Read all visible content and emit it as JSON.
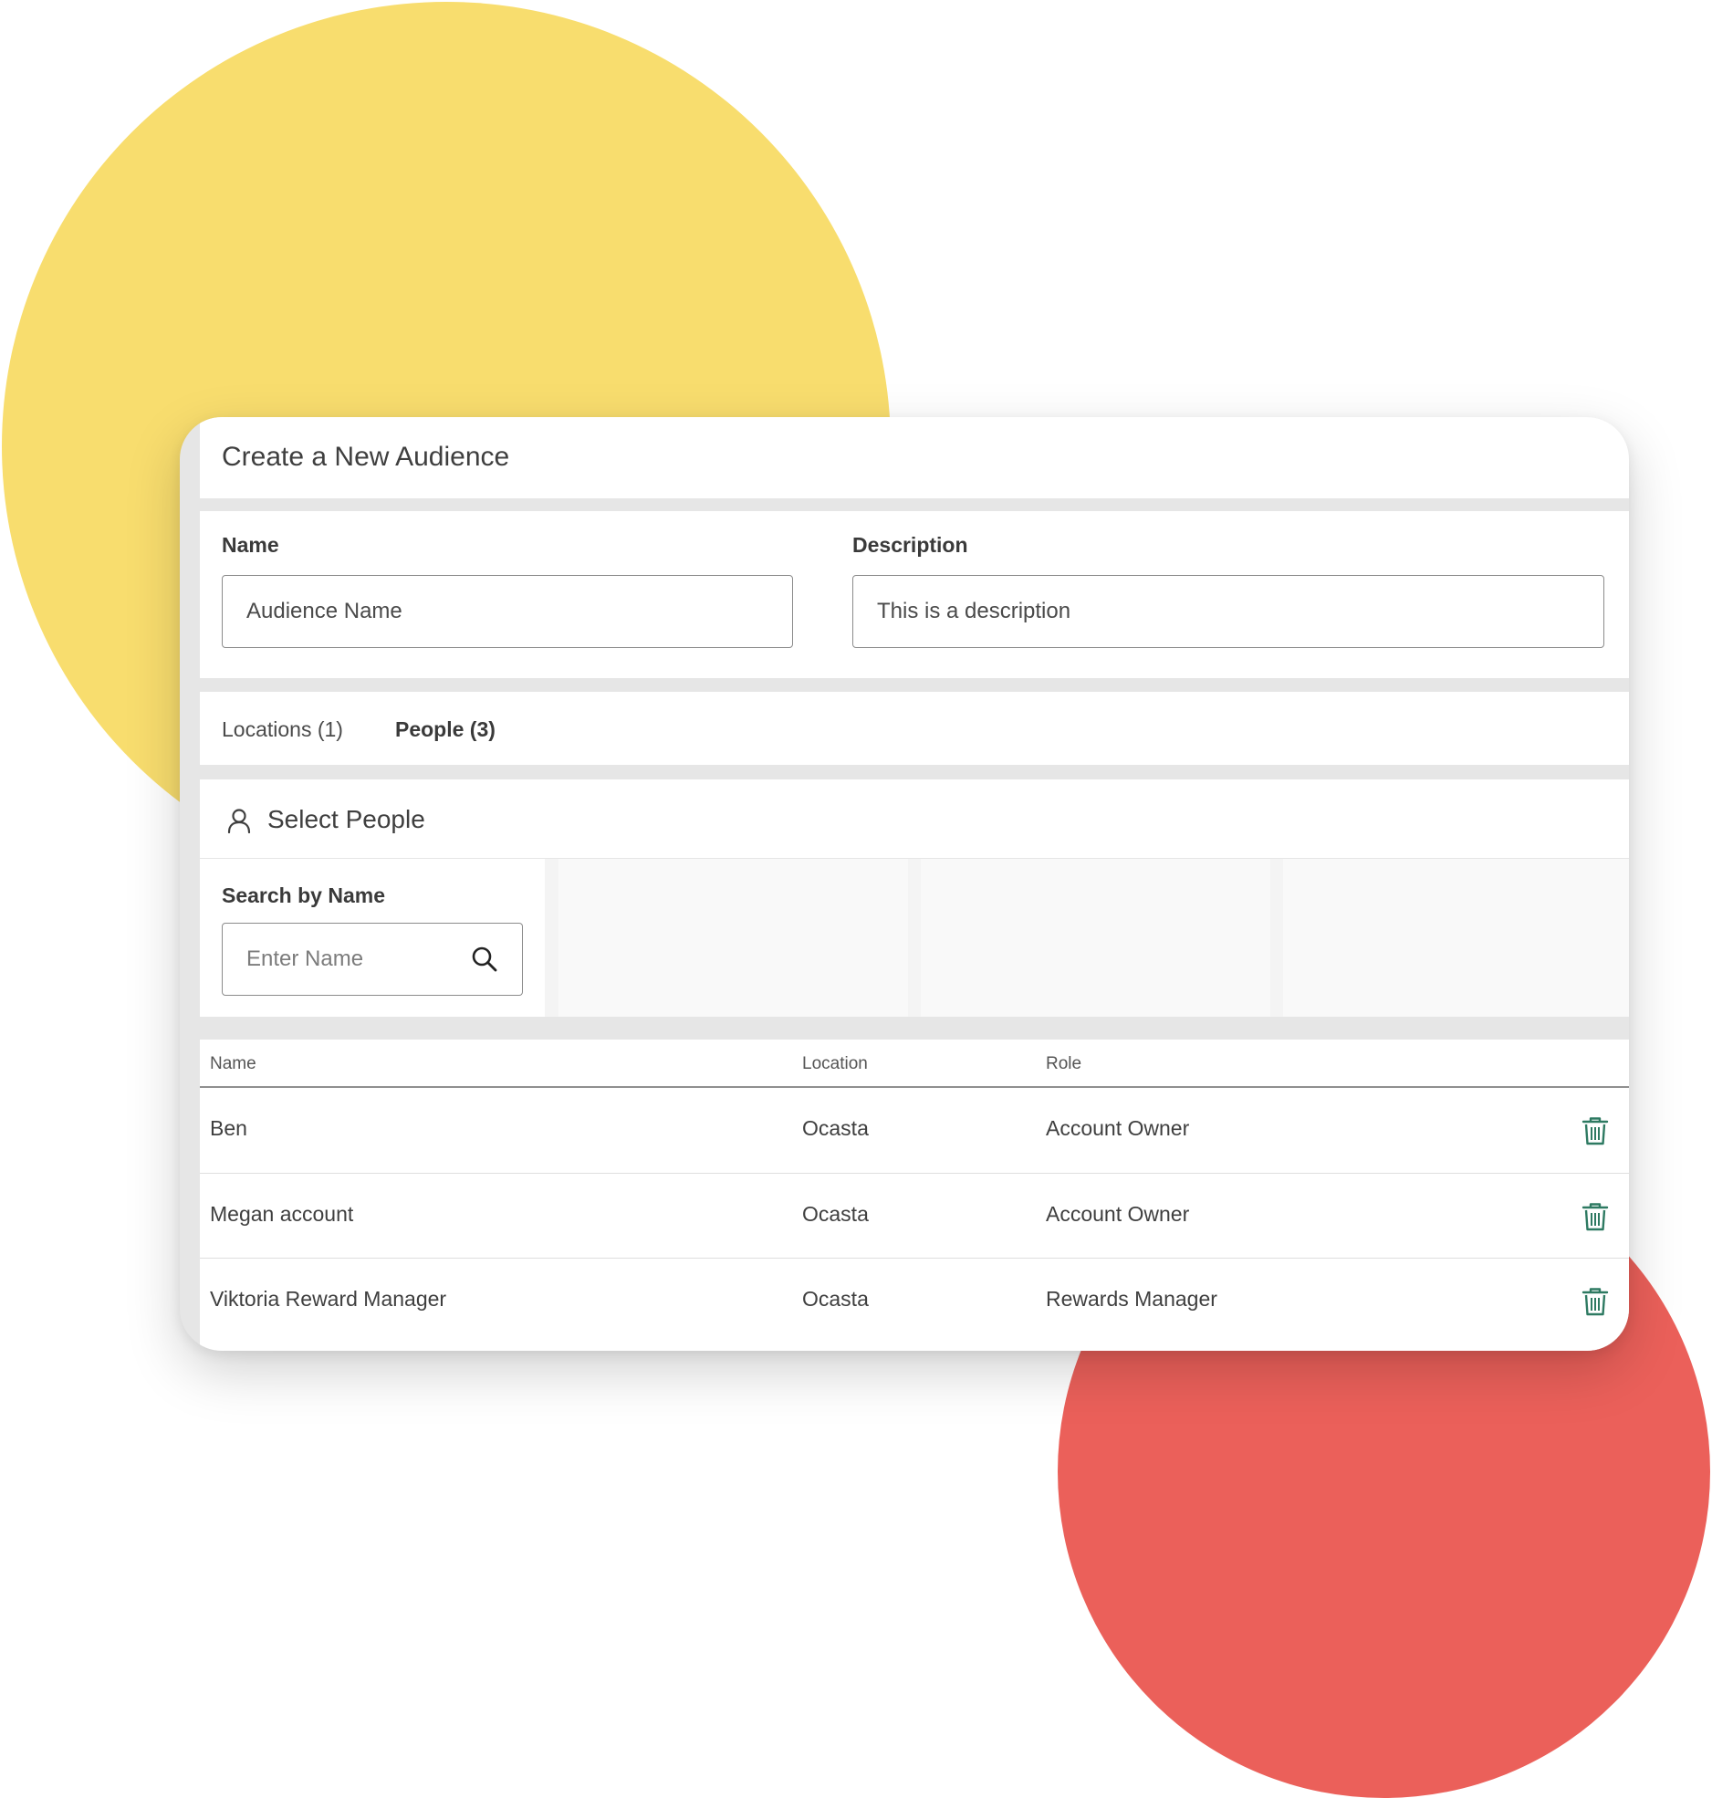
{
  "header": {
    "title": "Create a New Audience"
  },
  "form": {
    "name_label": "Name",
    "name_value": "Audience Name",
    "description_label": "Description",
    "description_value": "This is a description"
  },
  "tabs": [
    {
      "label": "Locations (1)",
      "active": false
    },
    {
      "label": "People (3)",
      "active": true
    }
  ],
  "select_people": {
    "title": "Select People",
    "icon": "user-icon"
  },
  "search": {
    "label": "Search by Name",
    "placeholder": "Enter Name",
    "button_icon": "search-icon"
  },
  "table": {
    "columns": [
      "Name",
      "Location",
      "Role"
    ],
    "rows": [
      {
        "name": "Ben",
        "location": "Ocasta",
        "role": "Account Owner"
      },
      {
        "name": "Megan account",
        "location": "Ocasta",
        "role": "Account Owner"
      },
      {
        "name": "Viktoria Reward Manager",
        "location": "Ocasta",
        "role": "Rewards Manager"
      }
    ],
    "row_action_icon": "trash-icon"
  },
  "colors": {
    "yellow_circle": "#f8dd6e",
    "red_circle": "#eb605a",
    "trash_icon": "#2e7a62"
  }
}
